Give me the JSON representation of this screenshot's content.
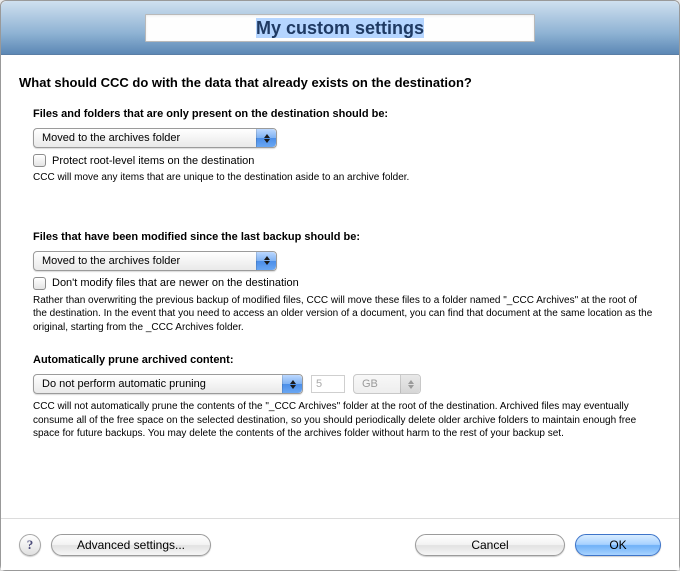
{
  "title": "My custom settings",
  "heading": "What should CCC do with the data that already exists on the destination?",
  "section1": {
    "label": "Files and folders that are only present on the destination should be:",
    "select_value": "Moved to the archives folder",
    "checkbox_label": "Protect root-level items on the destination",
    "description": "CCC will move any items that are unique to the destination aside to an archive folder."
  },
  "section2": {
    "label": "Files that have been modified since the last backup should be:",
    "select_value": "Moved to the archives folder",
    "checkbox_label": "Don't modify files that are newer on the destination",
    "description": "Rather than overwriting the previous backup of modified files, CCC will move these files to a folder named \"_CCC Archives\" at the root of the destination. In the event that you need to access an older version of a document, you can find that document at the same location as the original, starting from the _CCC Archives folder."
  },
  "section3": {
    "label": "Automatically prune archived content:",
    "select_value": "Do not perform automatic pruning",
    "size_value": "5",
    "unit_value": "GB",
    "description": "CCC will not automatically prune the contents of the \"_CCC Archives\" folder at the root of the destination. Archived files may eventually consume all of the free space on the selected destination, so you should periodically delete older archive folders to maintain enough free space for future backups. You may delete the contents of the archives folder without harm to the rest of your backup set."
  },
  "footer": {
    "help": "?",
    "advanced": "Advanced settings...",
    "cancel": "Cancel",
    "ok": "OK"
  }
}
